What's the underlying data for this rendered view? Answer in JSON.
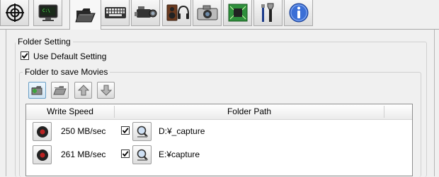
{
  "tabs": [
    {
      "icon": "crosshair-icon"
    },
    {
      "icon": "monitor-icon"
    },
    {
      "icon": "folder-icon",
      "active": true
    },
    {
      "icon": "keyboard-icon"
    },
    {
      "icon": "camcorder-icon"
    },
    {
      "icon": "speaker-headphones-icon"
    },
    {
      "icon": "camera-icon"
    },
    {
      "icon": "chip-icon"
    },
    {
      "icon": "tools-icon"
    },
    {
      "icon": "info-icon"
    }
  ],
  "folder_setting": {
    "title": "Folder Setting",
    "use_default_label": "Use Default Setting",
    "use_default_checked": true
  },
  "movies": {
    "title": "Folder to save Movies",
    "toolbar": [
      {
        "icon": "add-folder-icon"
      },
      {
        "icon": "remove-folder-icon"
      },
      {
        "icon": "arrow-up-icon"
      },
      {
        "icon": "arrow-down-icon"
      }
    ],
    "columns": [
      "Write Speed",
      "Folder Path"
    ],
    "rows": [
      {
        "speed": "250 MB/sec",
        "checked": true,
        "path": "D:¥_capture"
      },
      {
        "speed": "261 MB/sec",
        "checked": true,
        "path": "E:¥capture"
      }
    ]
  },
  "colors": {
    "accent_green": "#3aa63a",
    "info_blue": "#3b6fd6"
  }
}
